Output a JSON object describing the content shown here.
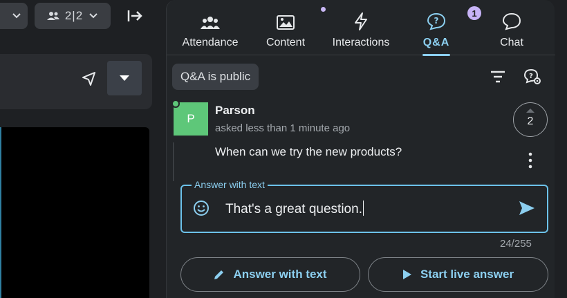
{
  "left": {
    "participants_count": "2|2"
  },
  "tabs": [
    {
      "id": "attendance",
      "label": "Attendance"
    },
    {
      "id": "content",
      "label": "Content"
    },
    {
      "id": "interactions",
      "label": "Interactions"
    },
    {
      "id": "qa",
      "label": "Q&A",
      "badge": "1"
    },
    {
      "id": "chat",
      "label": "Chat"
    }
  ],
  "qa": {
    "public_label": "Q&A is public",
    "question": {
      "avatar_letter": "P",
      "author": "Parson",
      "asked": "asked less than 1 minute ago",
      "text": "When can we try the new products?",
      "votes": "2"
    },
    "answer": {
      "legend": "Answer with text",
      "value": "That's a great question.",
      "char_count": "24/255"
    },
    "buttons": {
      "answer_text": "Answer with text",
      "live_answer": "Start live answer"
    }
  },
  "colors": {
    "accent": "#8ccff0",
    "badge": "#c7b3f7",
    "avatar": "#5ec779",
    "panel_bg": "#222528"
  }
}
